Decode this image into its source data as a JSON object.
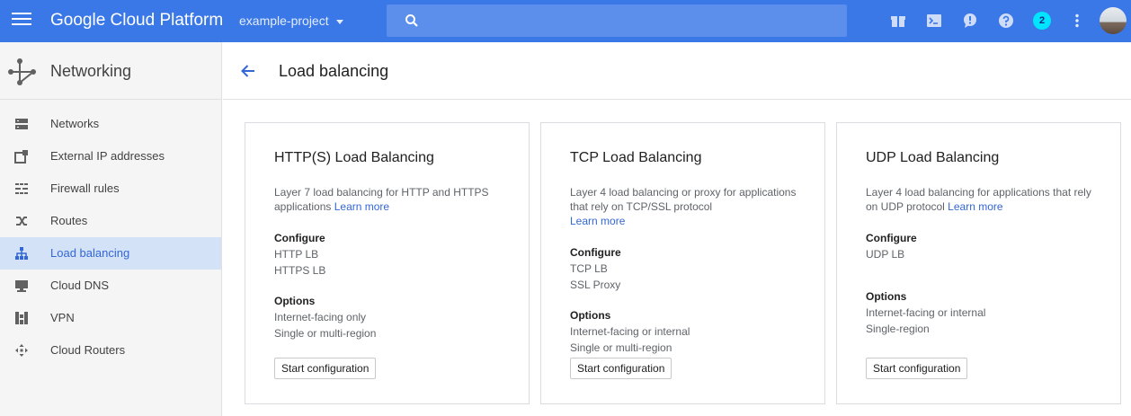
{
  "header": {
    "brand": "Google Cloud Platform",
    "project": "example-project",
    "search_placeholder": "",
    "notification_count": "2",
    "accent": "#3b78e7"
  },
  "sidebar": {
    "title": "Networking",
    "items": [
      {
        "label": "Networks",
        "icon": "networks-icon"
      },
      {
        "label": "External IP addresses",
        "icon": "external-ip-icon"
      },
      {
        "label": "Firewall rules",
        "icon": "firewall-icon"
      },
      {
        "label": "Routes",
        "icon": "routes-icon"
      },
      {
        "label": "Load balancing",
        "icon": "load-balancing-icon",
        "active": true
      },
      {
        "label": "Cloud DNS",
        "icon": "dns-icon"
      },
      {
        "label": "VPN",
        "icon": "vpn-icon"
      },
      {
        "label": "Cloud Routers",
        "icon": "routers-icon"
      }
    ]
  },
  "main": {
    "title": "Load balancing",
    "cards": [
      {
        "title": "HTTP(S) Load Balancing",
        "desc": "Layer 7 load balancing for HTTP and HTTPS applications",
        "learn_more": "Learn more",
        "configure_label": "Configure",
        "configure": [
          "HTTP LB",
          "HTTPS LB"
        ],
        "options_label": "Options",
        "options": [
          "Internet-facing only",
          "Single or multi-region"
        ],
        "button": "Start configuration"
      },
      {
        "title": "TCP Load Balancing",
        "desc": "Layer 4 load balancing or proxy for applications that rely on TCP/SSL protocol",
        "learn_more": "Learn more",
        "configure_label": "Configure",
        "configure": [
          "TCP LB",
          "SSL Proxy"
        ],
        "options_label": "Options",
        "options": [
          "Internet-facing or internal",
          "Single or multi-region"
        ],
        "button": "Start configuration"
      },
      {
        "title": "UDP Load Balancing",
        "desc": "Layer 4 load balancing for applications that rely on UDP protocol",
        "learn_more": "Learn more",
        "configure_label": "Configure",
        "configure": [
          "UDP LB"
        ],
        "options_label": "Options",
        "options": [
          "Internet-facing or internal",
          "Single-region"
        ],
        "button": "Start configuration"
      }
    ]
  }
}
